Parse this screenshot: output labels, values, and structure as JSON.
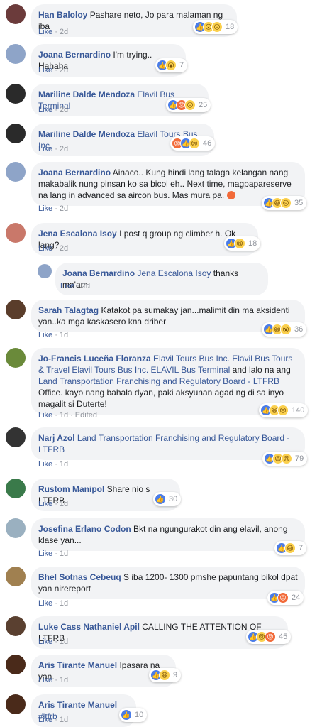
{
  "comments": [
    {
      "author": "Han Baloloy",
      "text": " Pashare neto, Jo para malaman ng iba",
      "like": "Like",
      "time": "2d",
      "count": "18",
      "reactions": [
        "like",
        "wow",
        "sad"
      ],
      "avatar": "#6b3b3b"
    },
    {
      "author": "Joana Bernardino",
      "text": " I'm trying.. Hahaha",
      "like": "Like",
      "time": "2d",
      "count": "7",
      "reactions": [
        "like",
        "wow"
      ],
      "avatar": "#8ea4c8"
    },
    {
      "author": "Mariline Dalde Mendoza",
      "mention": " Elavil Bus Terminal",
      "like": "Like",
      "time": "2d",
      "count": "25",
      "reactions": [
        "like",
        "angry",
        "sad"
      ],
      "avatar": "#2a2a2a"
    },
    {
      "author": "Mariline Dalde Mendoza",
      "mention": " Elavil Tours Bus Inc.",
      "like": "Like",
      "time": "2d",
      "count": "46",
      "reactions": [
        "angry",
        "like",
        "sad"
      ],
      "avatar": "#2a2a2a"
    },
    {
      "author": "Joana Bernardino",
      "text": " Ainaco.. Kung hindi lang talaga kelangan nang makabalik nung pinsan ko sa bicol eh.. Next time, magpapareserve na lang in advanced sa aircon bus. Mas mura pa.",
      "like": "Like",
      "time": "2d",
      "count": "35",
      "reactions": [
        "like",
        "haha",
        "sad"
      ],
      "avatar": "#8ea4c8"
    },
    {
      "author": "Jena Escalona Isoy",
      "text": " I post q group ng climber h. Ok lang?",
      "like": "Like",
      "time": "2d",
      "count": "18",
      "reactions": [
        "like",
        "haha"
      ],
      "avatar": "#c9786a"
    },
    {
      "author": "Joana Bernardino",
      "mention": " Jena Escalona Isoy",
      "text": " thanks ma'am.",
      "like": "Like",
      "time": "2d",
      "avatar": "#8ea4c8"
    },
    {
      "author": "Sarah Talagtag",
      "text": " Katakot pa sumakay jan...malimit din ma aksidenti yan..ka mga kaskasero kna driber",
      "like": "Like",
      "time": "1d",
      "count": "36",
      "reactions": [
        "like",
        "haha",
        "wow"
      ],
      "avatar": "#5a3d2b"
    },
    {
      "author": "Jo-Francis Luceña Floranza",
      "mention": " Elavil Tours Bus Inc. Elavil Bus Tours & Travel Elavil Tours Bus Inc. ELAVIL Bus Terminal",
      "text": " and lalo na ang ",
      "mention2": "Land Transportation Franchising and Regulatory Board - LTFRB",
      "text2": " Office. kayo nang bahala dyan, paki aksyunan agad ng di sa inyo magalit si Duterte!",
      "like": "Like",
      "time": "1d",
      "edited": "Edited",
      "count": "140",
      "reactions": [
        "like",
        "haha",
        "sad"
      ],
      "avatar": "#6a8a3a"
    },
    {
      "author": "Narj Azol",
      "mention": " Land Transportation Franchising and Regulatory Board - LTFRB",
      "like": "Like",
      "time": "1d",
      "count": "79",
      "reactions": [
        "like",
        "haha",
        "sad"
      ],
      "avatar": "#333333"
    },
    {
      "author": "Rustom Manipol",
      "text": " Share nio s LTFRB",
      "like": "Like",
      "time": "1d",
      "count": "30",
      "reactions": [
        "like"
      ],
      "avatar": "#3a7a4a"
    },
    {
      "author": "Josefina Erlano Codon",
      "text": " Bkt na ngungurakot din ang elavil, anong klase yan...",
      "like": "Like",
      "time": "1d",
      "count": "7",
      "reactions": [
        "like",
        "haha"
      ],
      "avatar": "#9ab0c0"
    },
    {
      "author": "Bhel Sotnas Cebeuq",
      "text": " S iba 1200- 1300 pmshe papuntang bikol dpat yan nirereport",
      "like": "Like",
      "time": "1d",
      "count": "24",
      "reactions": [
        "like",
        "angry"
      ],
      "avatar": "#a08050"
    },
    {
      "author": "Luke Cass Nathaniel Apil",
      "text": " CALLING THE ATTENTION OF LTFRB",
      "like": "Like",
      "time": "1d",
      "count": "45",
      "reactions": [
        "like",
        "sad",
        "angry"
      ],
      "avatar": "#5a4030"
    },
    {
      "author": "Aris Tirante Manuel",
      "text": " Ipasara na yan.",
      "like": "Like",
      "time": "1d",
      "count": "9",
      "reactions": [
        "like",
        "haha"
      ],
      "avatar": "#4a2a1a"
    },
    {
      "author": "Aris Tirante Manuel",
      "mention": " #ltfrb",
      "like": "Like",
      "time": "1d",
      "count": "10",
      "reactions": [
        "like"
      ],
      "avatar": "#4a2a1a"
    }
  ],
  "reaction_glyphs": {
    "like": "👍",
    "haha": "😆",
    "wow": "😮",
    "sad": "😢",
    "angry": "😡"
  },
  "colors": {
    "link": "#385898",
    "bubble": "#f2f3f5",
    "meta": "#90949c"
  }
}
